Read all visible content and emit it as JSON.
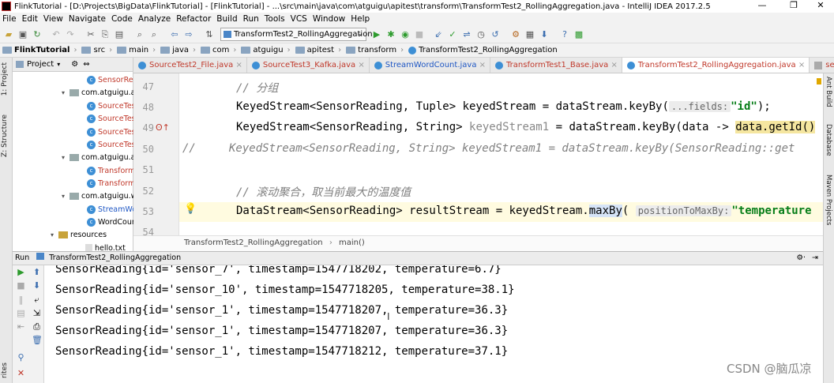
{
  "titlebar": {
    "title": "FlinkTutorial - [D:\\Projects\\BigData\\FlinkTutorial] - [FlinkTutorial] - ...\\src\\main\\java\\com\\atguigu\\apitest\\transform\\TransformTest2_RollingAggregation.java - IntelliJ IDEA 2017.2.5",
    "minimize": "—",
    "maximize": "❐",
    "close": "✕"
  },
  "menu": [
    "File",
    "Edit",
    "View",
    "Navigate",
    "Code",
    "Analyze",
    "Refactor",
    "Build",
    "Run",
    "Tools",
    "VCS",
    "Window",
    "Help"
  ],
  "toolbar": {
    "run_config": "TransformTest2_RollingAggregation"
  },
  "breadcrumbs": [
    "FlinkTutorial",
    "src",
    "main",
    "java",
    "com",
    "atguigu",
    "apitest",
    "transform",
    "TransformTest2_RollingAggregation"
  ],
  "side_tabs": {
    "project": "1: Project",
    "structure": "Z: Structure",
    "favorites": "rites"
  },
  "right_tabs": [
    "Ant Build",
    "Database",
    "Maven Projects"
  ],
  "project_panel": {
    "header": "Project",
    "items": [
      {
        "label": "SensorRe",
        "kind": "class",
        "color": "red"
      },
      {
        "label": "com.atguigu.a",
        "kind": "package"
      },
      {
        "label": "SourceTes",
        "kind": "class",
        "color": "red"
      },
      {
        "label": "SourceTes",
        "kind": "class",
        "color": "red"
      },
      {
        "label": "SourceTes",
        "kind": "class",
        "color": "red"
      },
      {
        "label": "SourceTes",
        "kind": "class",
        "color": "red"
      },
      {
        "label": "com.atguigu.a",
        "kind": "package"
      },
      {
        "label": "Transform",
        "kind": "class",
        "color": "red"
      },
      {
        "label": "Transform",
        "kind": "class",
        "color": "red"
      },
      {
        "label": "com.atguigu.w",
        "kind": "package"
      },
      {
        "label": "StreamWo",
        "kind": "class",
        "color": "blue"
      },
      {
        "label": "WordCour",
        "kind": "class",
        "color": "black"
      },
      {
        "label": "resources",
        "kind": "folder"
      },
      {
        "label": "hello.txt",
        "kind": "file"
      }
    ]
  },
  "editor_tabs": [
    {
      "label": "SourceTest2_File.java",
      "color": "red"
    },
    {
      "label": "SourceTest3_Kafka.java",
      "color": "red"
    },
    {
      "label": "StreamWordCount.java",
      "color": "blue"
    },
    {
      "label": "TransformTest1_Base.java",
      "color": "red"
    },
    {
      "label": "TransformTest2_RollingAggregation.java",
      "color": "red",
      "active": true
    },
    {
      "label": "sensor.txt",
      "color": "red"
    }
  ],
  "editor": {
    "lines": [
      {
        "num": "47",
        "comment": "// 分组"
      },
      {
        "num": "48",
        "pre": "KeyedStream<SensorReading, Tuple> keyedStream = dataStream.keyBy(",
        "hint": "...fields:",
        "str": "\"id\"",
        "post": ");"
      },
      {
        "num": "49",
        "pre": "KeyedStream<SensorReading, String> ",
        "grey": "keyedStream1",
        "mid": " = dataStream.keyBy(data -> ",
        "hl": "data.getId()"
      },
      {
        "num": "50",
        "commentline": "//     KeyedStream<SensorReading, String> keyedStream1 = dataStream.keyBy(SensorReading::get"
      },
      {
        "num": "51"
      },
      {
        "num": "52",
        "comment": "// 滚动聚合，取当前最大的温度值"
      },
      {
        "num": "53",
        "pre": "DataStream<SensorReading> resultStream = keyedStream.",
        "hlm": "maxBy",
        "paren": "(",
        "hint": "positionToMaxBy:",
        "str": "\"temperature"
      },
      {
        "num": "54"
      }
    ],
    "breadcrumb": [
      "TransformTest2_RollingAggregation",
      "main()"
    ]
  },
  "run_panel": {
    "title": "Run",
    "config": "TransformTest2_RollingAggregation",
    "output": [
      "SensorReading{id='sensor_7', timestamp=1547718202, temperature=6.7}",
      "SensorReading{id='sensor_10', timestamp=1547718205, temperature=38.1}",
      "SensorReading{id='sensor_1', timestamp=1547718207, temperature=36.3}",
      "SensorReading{id='sensor_1', timestamp=1547718207, temperature=36.3}",
      "SensorReading{id='sensor_1', timestamp=1547718212, temperature=37.1}"
    ]
  },
  "watermark": "CSDN @脑瓜凉"
}
